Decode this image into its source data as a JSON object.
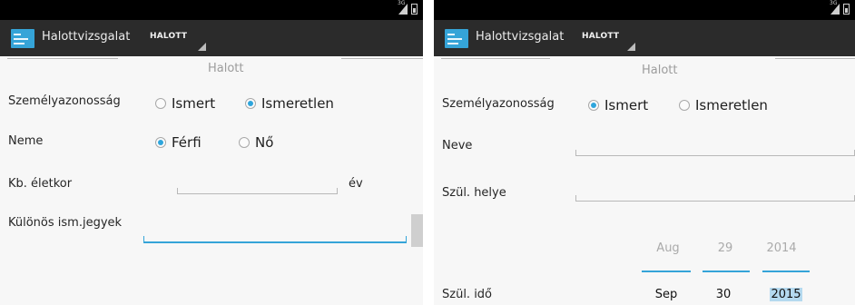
{
  "app_title": "Halottvizsgalat",
  "spinner_value": "HALOTT",
  "section_title": "Halott",
  "colors": {
    "accent": "#35a4d8",
    "actionbar": "#2b2b2b",
    "statusbar": "#000000"
  },
  "panel1": {
    "identity_label": "Személyazonosság",
    "identity_options": [
      "Ismert",
      "Ismeretlen"
    ],
    "identity_selected": "Ismeretlen",
    "sex_label": "Neme",
    "sex_options": [
      "Férfi",
      "Nő"
    ],
    "sex_selected": "Férfi",
    "age_label": "Kb. életkor",
    "age_value": "",
    "age_unit": "év",
    "marks_label": "Különös ism.jegyek",
    "marks_value": ""
  },
  "panel2": {
    "identity_label": "Személyazonosság",
    "identity_options": [
      "Ismert",
      "Ismeretlen"
    ],
    "identity_selected": "Ismert",
    "name_label": "Neve",
    "name_value": "",
    "birthplace_label": "Szül. helye",
    "birthplace_value": "",
    "birthdate_label": "Szül. idő",
    "date_picker": {
      "prev": {
        "month": "Aug",
        "day": "29",
        "year": "2014"
      },
      "current": {
        "month": "Sep",
        "day": "30",
        "year": "2015"
      }
    }
  }
}
